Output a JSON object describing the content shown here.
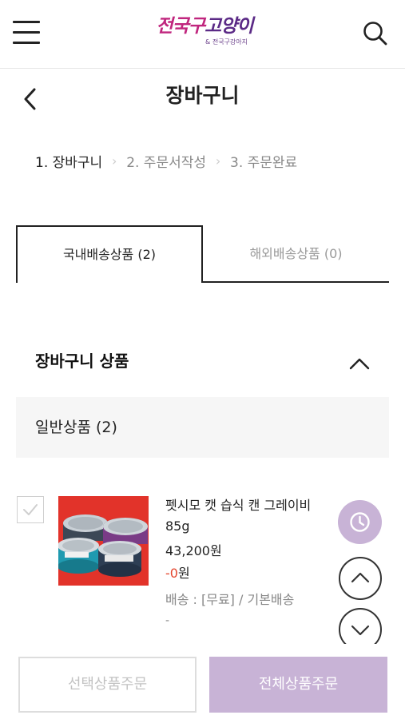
{
  "header": {
    "logo_text_a": "전국구",
    "logo_text_b": "고양이",
    "logo_sub": "& 전국구강아지"
  },
  "page": {
    "title": "장바구니"
  },
  "steps": [
    {
      "label": "1. 장바구니",
      "active": true
    },
    {
      "label": "2. 주문서작성",
      "active": false
    },
    {
      "label": "3. 주문완료",
      "active": false
    }
  ],
  "tabs": {
    "domestic": "국내배송상품 (2)",
    "overseas": "해외배송상품 (0)"
  },
  "cart": {
    "section_title": "장바구니 상품",
    "group_label": "일반상품 (2)",
    "items": [
      {
        "name": "펫시모 캣 습식 캔 그레이비 85g",
        "price": "43,200원",
        "discount_value": "-0",
        "discount_unit": "원",
        "shipping": "배송 : [무료] / 기본배송",
        "extra": "-"
      }
    ]
  },
  "buttons": {
    "order_selected": "선택상품주문",
    "order_all": "전체상품주문"
  },
  "colors": {
    "accent_lavender": "#c8b3d6",
    "discount_red": "#e4452d",
    "logo_purple": "#7b2d8e",
    "product_bg": "#e2332a"
  }
}
